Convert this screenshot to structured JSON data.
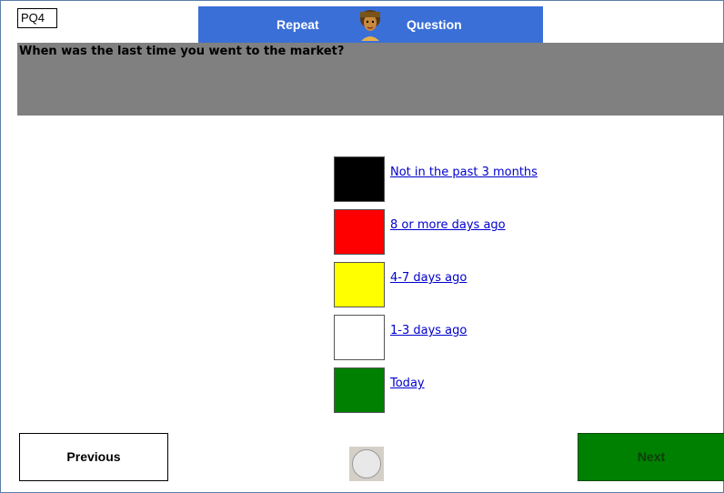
{
  "question_id": "PQ4",
  "topbar": {
    "repeat_label": "Repeat",
    "question_label": "Question",
    "color": "#3a6fd8",
    "avatar_icon": "narrator-avatar-icon"
  },
  "question": {
    "text": "When was the last time you went to the market?",
    "background": "#808080"
  },
  "options": [
    {
      "label": "Not in the past 3 months",
      "color": "#000000"
    },
    {
      "label": "8 or more days ago",
      "color": "#ff0000"
    },
    {
      "label": "4-7 days ago",
      "color": "#ffff00"
    },
    {
      "label": "1-3 days ago",
      "color": "#ffffff"
    },
    {
      "label": "Today",
      "color": "#008000"
    }
  ],
  "navigation": {
    "previous_label": "Previous",
    "next_label": "Next",
    "next_color": "#008000"
  }
}
